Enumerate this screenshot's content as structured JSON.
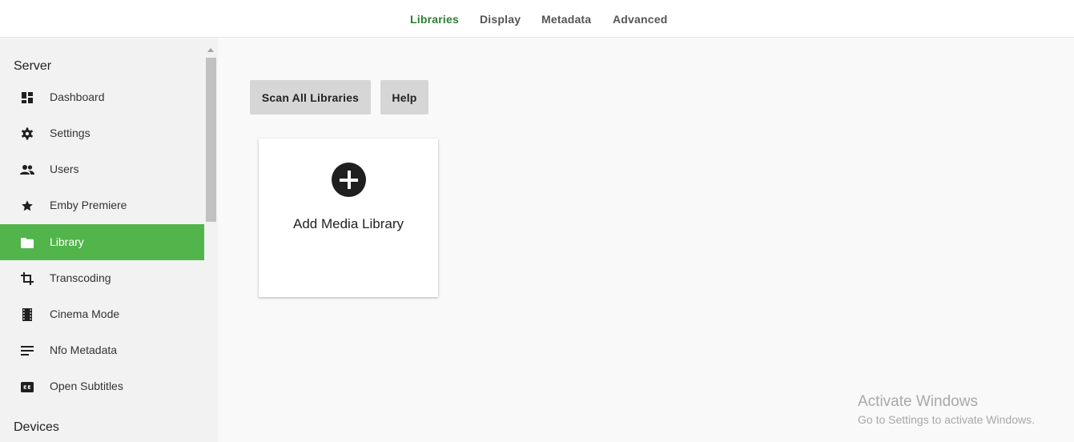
{
  "tabs": [
    {
      "label": "Libraries",
      "active": true
    },
    {
      "label": "Display",
      "active": false
    },
    {
      "label": "Metadata",
      "active": false
    },
    {
      "label": "Advanced",
      "active": false
    }
  ],
  "sidebar": {
    "server_title": "Server",
    "devices_title": "Devices",
    "items": [
      {
        "label": "Dashboard",
        "icon": "dashboard-icon"
      },
      {
        "label": "Settings",
        "icon": "gear-icon"
      },
      {
        "label": "Users",
        "icon": "people-icon"
      },
      {
        "label": "Emby Premiere",
        "icon": "star-icon"
      },
      {
        "label": "Library",
        "icon": "folder-icon",
        "active": true
      },
      {
        "label": "Transcoding",
        "icon": "crop-icon"
      },
      {
        "label": "Cinema Mode",
        "icon": "film-icon"
      },
      {
        "label": "Nfo Metadata",
        "icon": "notes-icon"
      },
      {
        "label": "Open Subtitles",
        "icon": "closed-caption-icon"
      }
    ]
  },
  "main": {
    "scan_button": "Scan All Libraries",
    "help_button": "Help",
    "add_library_label": "Add Media Library"
  },
  "watermark": {
    "title": "Activate Windows",
    "subtitle": "Go to Settings to activate Windows."
  },
  "colors": {
    "accent": "#52b54b",
    "active_tab": "#2e7d32"
  }
}
